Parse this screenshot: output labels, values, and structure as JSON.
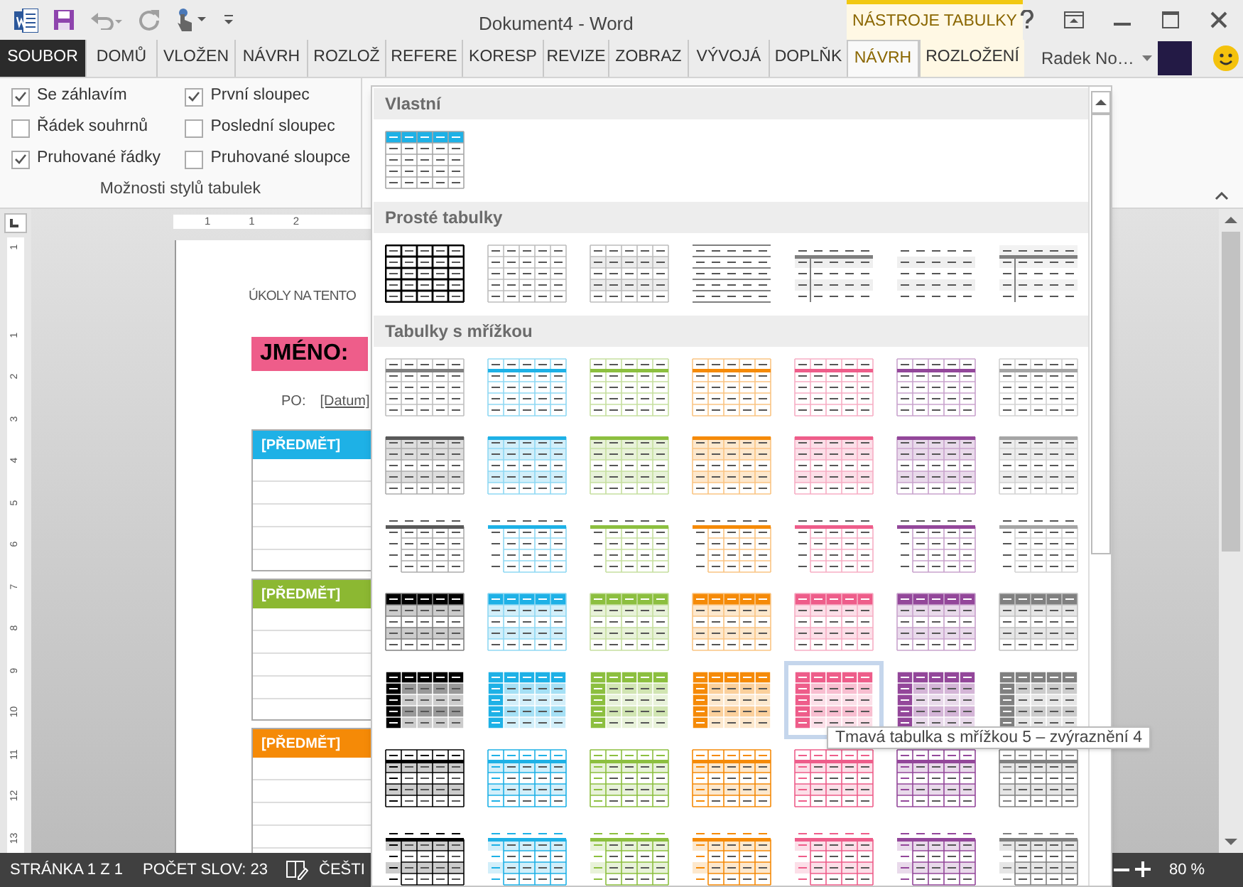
{
  "title_bar": {
    "title": "Dokument4 - Word",
    "context_label": "NÁSTROJE TABULKY"
  },
  "tabs": [
    {
      "label": "SOUBOR",
      "kind": "file",
      "selected": false
    },
    {
      "label": "DOMŮ",
      "kind": "main",
      "selected": false
    },
    {
      "label": "VLOŽEN",
      "kind": "main",
      "selected": false
    },
    {
      "label": "NÁVRH",
      "kind": "main",
      "selected": false
    },
    {
      "label": "ROZLOŽ",
      "kind": "main",
      "selected": false
    },
    {
      "label": "REFERE",
      "kind": "main",
      "selected": false
    },
    {
      "label": "KORESP",
      "kind": "main",
      "selected": false
    },
    {
      "label": "REVIZE",
      "kind": "main",
      "selected": false
    },
    {
      "label": "ZOBRAZ",
      "kind": "main",
      "selected": false
    },
    {
      "label": "VÝVOJÁ",
      "kind": "main",
      "selected": false
    },
    {
      "label": "DOPLŇK",
      "kind": "main",
      "selected": false
    },
    {
      "label": "NÁVRH",
      "kind": "context",
      "selected": true
    },
    {
      "label": "ROZLOŽENÍ",
      "kind": "context",
      "selected": false
    }
  ],
  "account": {
    "name": "Radek No…"
  },
  "style_options": {
    "group_label": "Možnosti stylů tabulek",
    "options": [
      {
        "label": "Se záhlavím",
        "checked": true
      },
      {
        "label": "Řádek souhrnů",
        "checked": false
      },
      {
        "label": "Pruhované řádky",
        "checked": true
      },
      {
        "label": "První sloupec",
        "checked": true
      },
      {
        "label": "Poslední sloupec",
        "checked": false
      },
      {
        "label": "Pruhované sloupce",
        "checked": false
      }
    ]
  },
  "rulers": {
    "horizontal": [
      "1",
      "1",
      "2"
    ],
    "vertical": [
      "1",
      "1",
      "2",
      "3",
      "4",
      "5",
      "6",
      "7",
      "8",
      "9",
      "10",
      "11",
      "12",
      "13"
    ]
  },
  "document": {
    "heading": "ÚKOLY NA TENTO",
    "name_label": "JMÉNO:",
    "day_label": "PO:",
    "date_placeholder": "[Datum]",
    "subjects": [
      {
        "label": "[PŘEDMĚT]",
        "color": "#1eb1e6"
      },
      {
        "label": "[PŘEDMĚT]",
        "color": "#8cb832"
      },
      {
        "label": "[PŘEDMĚT]",
        "color": "#f58a07"
      }
    ]
  },
  "gallery": {
    "tooltip": "Tmavá tabulka s mřížkou 5 – zvýraznění 4",
    "sections": [
      {
        "title": "Vlastní",
        "rows": [
          {
            "kind": "custom",
            "items": [
              {
                "color": "#1eb1e6",
                "selected": false
              }
            ]
          }
        ]
      },
      {
        "title": "Prosté tabulky",
        "rows": [
          {
            "kind": "plain",
            "items": [
              {
                "kind": "plain-grid-dark",
                "selected": false
              },
              {
                "kind": "plain-grid",
                "selected": false
              },
              {
                "kind": "plain-grid-banded",
                "selected": false
              },
              {
                "kind": "plain-lines",
                "selected": false
              },
              {
                "kind": "plain-first-col",
                "selected": false
              },
              {
                "kind": "plain-banded",
                "selected": false
              },
              {
                "kind": "plain-first-col-banded",
                "selected": false
              }
            ]
          }
        ]
      },
      {
        "title": "Tabulky s mřížkou",
        "rows": [
          {
            "kind": "grid-light",
            "items": [
              {
                "color": "#7f7f7f",
                "selected": false
              },
              {
                "color": "#1eb1e6",
                "selected": false
              },
              {
                "color": "#8cbf3f",
                "selected": false
              },
              {
                "color": "#f58a07",
                "selected": false
              },
              {
                "color": "#ee5d8a",
                "selected": false
              },
              {
                "color": "#93479a",
                "selected": false
              },
              {
                "color": "#a5a5a5",
                "selected": false
              }
            ]
          },
          {
            "kind": "grid-light-banded",
            "items": [
              {
                "color": "#595959",
                "selected": false
              },
              {
                "color": "#1eb1e6",
                "selected": false
              },
              {
                "color": "#8cbf3f",
                "selected": false
              },
              {
                "color": "#f58a07",
                "selected": false
              },
              {
                "color": "#ee5d8a",
                "selected": false
              },
              {
                "color": "#93479a",
                "selected": false
              },
              {
                "color": "#a5a5a5",
                "selected": false
              }
            ]
          },
          {
            "kind": "grid-first-col",
            "items": [
              {
                "color": "#595959",
                "selected": false
              },
              {
                "color": "#1eb1e6",
                "selected": false
              },
              {
                "color": "#8cbf3f",
                "selected": false
              },
              {
                "color": "#f58a07",
                "selected": false
              },
              {
                "color": "#ee5d8a",
                "selected": false
              },
              {
                "color": "#93479a",
                "selected": false
              },
              {
                "color": "#a5a5a5",
                "selected": false
              }
            ]
          },
          {
            "kind": "grid-dark-header",
            "items": [
              {
                "color": "#000000",
                "selected": false
              },
              {
                "color": "#1eb1e6",
                "selected": false
              },
              {
                "color": "#8cbf3f",
                "selected": false
              },
              {
                "color": "#f58a07",
                "selected": false
              },
              {
                "color": "#ee5d8a",
                "selected": false
              },
              {
                "color": "#93479a",
                "selected": false
              },
              {
                "color": "#808080",
                "selected": false
              }
            ]
          },
          {
            "kind": "grid-dark-first-col",
            "items": [
              {
                "color": "#000000",
                "selected": false
              },
              {
                "color": "#1eb1e6",
                "selected": false
              },
              {
                "color": "#8cbf3f",
                "selected": false
              },
              {
                "color": "#f58a07",
                "selected": false
              },
              {
                "color": "#ee5d8a",
                "selected": true
              },
              {
                "color": "#93479a",
                "selected": false
              },
              {
                "color": "#808080",
                "selected": false
              }
            ]
          },
          {
            "kind": "grid-colorful",
            "items": [
              {
                "color": "#000000",
                "selected": false
              },
              {
                "color": "#1eb1e6",
                "selected": false
              },
              {
                "color": "#8cbf3f",
                "selected": false
              },
              {
                "color": "#f58a07",
                "selected": false
              },
              {
                "color": "#ee5d8a",
                "selected": false
              },
              {
                "color": "#93479a",
                "selected": false
              },
              {
                "color": "#808080",
                "selected": false
              }
            ]
          },
          {
            "kind": "grid-colorful-first-col",
            "items": [
              {
                "color": "#000000",
                "selected": false
              },
              {
                "color": "#1eb1e6",
                "selected": false
              },
              {
                "color": "#8cbf3f",
                "selected": false
              },
              {
                "color": "#f58a07",
                "selected": false
              },
              {
                "color": "#ee5d8a",
                "selected": false
              },
              {
                "color": "#93479a",
                "selected": false
              },
              {
                "color": "#808080",
                "selected": false
              }
            ]
          }
        ]
      }
    ]
  },
  "status_bar": {
    "page": "STRÁNKA 1 Z 1",
    "words": "POČET SLOV: 23",
    "language": "ČEŠTI",
    "zoom": "80 %"
  }
}
